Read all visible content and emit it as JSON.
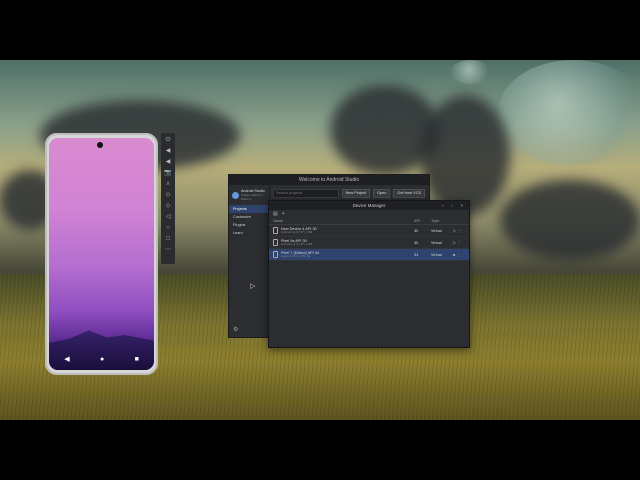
{
  "emulator": {
    "status_time": "",
    "nav": {
      "back": "◀",
      "home": "●",
      "recents": "■"
    },
    "toolbar_icons": [
      "⏻",
      "◀",
      "◀",
      "📷",
      "⌕",
      "◇",
      "◇",
      "◁",
      "○",
      "□",
      "⋯"
    ]
  },
  "welcome_window": {
    "title": "Welcome to Android Studio",
    "brand_name": "Android Studio",
    "brand_version": "Koala | 2024.1.1 Patch 1",
    "sidebar": [
      "Projects",
      "Customize",
      "Plugins",
      "Learn"
    ],
    "search_placeholder": "Search projects",
    "buttons": {
      "new_project": "New Project",
      "open": "Open",
      "vcs": "Get from VCS"
    }
  },
  "device_manager": {
    "title": "Device Manager",
    "window_controls": "– ▫ ×",
    "columns": {
      "name": "Name",
      "api": "API",
      "type": "Type"
    },
    "devices": [
      {
        "name": "New Device 4 API 30",
        "sub": "Android 11.0 (\"R\") | x86",
        "api": "30",
        "type": "Virtual"
      },
      {
        "name": "Pixel 9a API 30",
        "sub": "Android 11.0 (\"R\") | x86",
        "api": "30",
        "type": "Virtual"
      },
      {
        "name": "Pixel 7 (Edited) API 34",
        "sub": "Android 14.0 | x86_64",
        "api": "34",
        "type": "Virtual"
      }
    ]
  }
}
